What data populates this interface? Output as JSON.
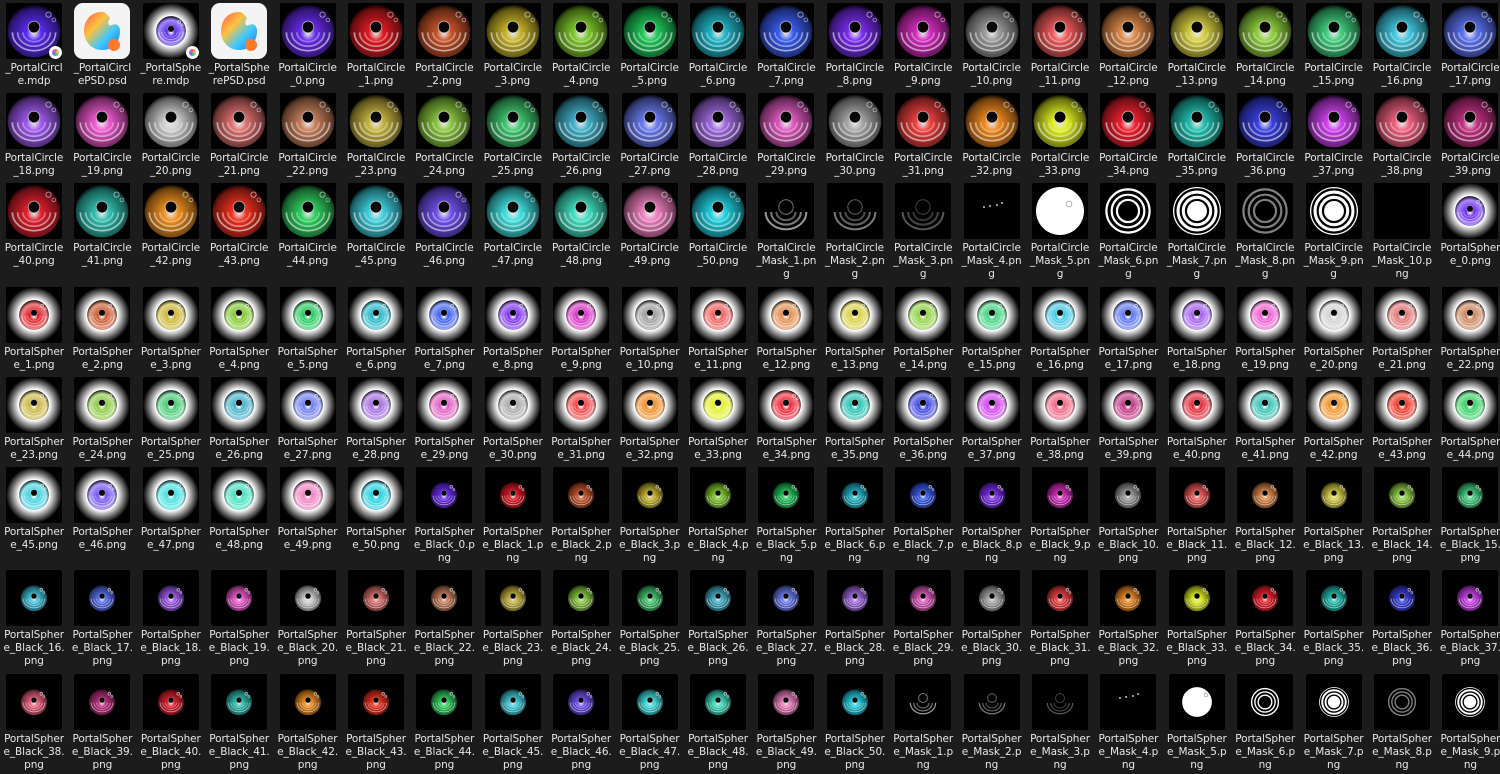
{
  "files": [
    {
      "label": "_PortalCircl\ne.mdp",
      "kind": "mdp-circle",
      "color": "#5a2cf0"
    },
    {
      "label": "_PortalCircl\nePSD.psd",
      "kind": "app"
    },
    {
      "label": "_PortalSphe\nre.mdp",
      "kind": "mdp-sphere",
      "color": "#5a2cf0"
    },
    {
      "label": "_PortalSphe\nrePSD.psd",
      "kind": "app"
    },
    {
      "label": "PortalCircle\n_0.png",
      "kind": "circle",
      "color": "#6a2cf0"
    },
    {
      "label": "PortalCircle\n_1.png",
      "kind": "circle",
      "color": "#e01b24"
    },
    {
      "label": "PortalCircle\n_2.png",
      "kind": "circle",
      "color": "#c8542a"
    },
    {
      "label": "PortalCircle\n_3.png",
      "kind": "circle",
      "color": "#c8b42a"
    },
    {
      "label": "PortalCircle\n_4.png",
      "kind": "circle",
      "color": "#7ec82a"
    },
    {
      "label": "PortalCircle\n_5.png",
      "kind": "circle",
      "color": "#1fc85a"
    },
    {
      "label": "PortalCircle\n_6.png",
      "kind": "circle",
      "color": "#1fb6c8"
    },
    {
      "label": "PortalCircle\n_7.png",
      "kind": "circle",
      "color": "#3a5cf0"
    },
    {
      "label": "PortalCircle\n_8.png",
      "kind": "circle",
      "color": "#7a2cf0"
    },
    {
      "label": "PortalCircle\n_9.png",
      "kind": "circle",
      "color": "#d62cc0"
    },
    {
      "label": "PortalCircle\n_10.png",
      "kind": "circle",
      "color": "#9a9a9a"
    },
    {
      "label": "PortalCircle\n_11.png",
      "kind": "circle",
      "color": "#f05a5a"
    },
    {
      "label": "PortalCircle\n_12.png",
      "kind": "circle",
      "color": "#e08a4a"
    },
    {
      "label": "PortalCircle\n_13.png",
      "kind": "circle",
      "color": "#d8d040"
    },
    {
      "label": "PortalCircle\n_14.png",
      "kind": "circle",
      "color": "#90d040"
    },
    {
      "label": "PortalCircle\n_15.png",
      "kind": "circle",
      "color": "#40d080"
    },
    {
      "label": "PortalCircle\n_16.png",
      "kind": "circle",
      "color": "#40c8e0"
    },
    {
      "label": "PortalCircle\n_17.png",
      "kind": "circle",
      "color": "#5a70f0"
    },
    {
      "label": "PortalCircle\n_18.png",
      "kind": "circle",
      "color": "#a05af0"
    },
    {
      "label": "PortalCircle\n_19.png",
      "kind": "circle",
      "color": "#f05ad0"
    },
    {
      "label": "PortalCircle\n_20.png",
      "kind": "circle",
      "color": "#d0d0d0"
    },
    {
      "label": "PortalCircle\n_21.png",
      "kind": "circle",
      "color": "#e07070"
    },
    {
      "label": "PortalCircle\n_22.png",
      "kind": "circle",
      "color": "#c8805a"
    },
    {
      "label": "PortalCircle\n_23.png",
      "kind": "circle",
      "color": "#c8b440"
    },
    {
      "label": "PortalCircle\n_24.png",
      "kind": "circle",
      "color": "#8ac840"
    },
    {
      "label": "PortalCircle\n_25.png",
      "kind": "circle",
      "color": "#40c870"
    },
    {
      "label": "PortalCircle\n_26.png",
      "kind": "circle",
      "color": "#40b0c8"
    },
    {
      "label": "PortalCircle\n_27.png",
      "kind": "circle",
      "color": "#6a7af0"
    },
    {
      "label": "PortalCircle\n_28.png",
      "kind": "circle",
      "color": "#a06ae0"
    },
    {
      "label": "PortalCircle\n_29.png",
      "kind": "circle",
      "color": "#e05ac0"
    },
    {
      "label": "PortalCircle\n_30.png",
      "kind": "circle",
      "color": "#a8a8a8"
    },
    {
      "label": "PortalCircle\n_31.png",
      "kind": "circle",
      "color": "#f04040"
    },
    {
      "label": "PortalCircle\n_32.png",
      "kind": "circle",
      "color": "#f08a20"
    },
    {
      "label": "PortalCircle\n_33.png",
      "kind": "circle",
      "color": "#e0f020"
    },
    {
      "label": "PortalCircle\n_34.png",
      "kind": "circle",
      "color": "#f02030"
    },
    {
      "label": "PortalCircle\n_35.png",
      "kind": "circle",
      "color": "#20c0b0"
    },
    {
      "label": "PortalCircle\n_36.png",
      "kind": "circle",
      "color": "#3a40e0"
    },
    {
      "label": "PortalCircle\n_37.png",
      "kind": "circle",
      "color": "#d040f0"
    },
    {
      "label": "PortalCircle\n_38.png",
      "kind": "circle",
      "color": "#f06080"
    },
    {
      "label": "PortalCircle\n_39.png",
      "kind": "circle",
      "color": "#c03080"
    },
    {
      "label": "PortalCircle\n_40.png",
      "kind": "circle",
      "color": "#e02030"
    },
    {
      "label": "PortalCircle\n_41.png",
      "kind": "circle",
      "color": "#30c0b0"
    },
    {
      "label": "PortalCircle\n_42.png",
      "kind": "circle",
      "color": "#f09020"
    },
    {
      "label": "PortalCircle\n_43.png",
      "kind": "circle",
      "color": "#f03020"
    },
    {
      "label": "PortalCircle\n_44.png",
      "kind": "circle",
      "color": "#30d060"
    },
    {
      "label": "PortalCircle\n_45.png",
      "kind": "circle",
      "color": "#40d0e0"
    },
    {
      "label": "PortalCircle\n_46.png",
      "kind": "circle",
      "color": "#7050f0"
    },
    {
      "label": "PortalCircle\n_47.png",
      "kind": "circle",
      "color": "#40e0e0"
    },
    {
      "label": "PortalCircle\n_48.png",
      "kind": "circle",
      "color": "#40e0c0"
    },
    {
      "label": "PortalCircle\n_49.png",
      "kind": "circle",
      "color": "#f080c0"
    },
    {
      "label": "PortalCircle\n_50.png",
      "kind": "circle",
      "color": "#20d0e0"
    },
    {
      "label": "PortalCircle\n_Mask_1.pn\ng",
      "kind": "mask-dark",
      "color": "#bfbfbf"
    },
    {
      "label": "PortalCircle\n_Mask_2.pn\ng",
      "kind": "mask-dark",
      "color": "#9a9a9a"
    },
    {
      "label": "PortalCircle\n_Mask_3.pn\ng",
      "kind": "mask-dark",
      "color": "#6a6a6a"
    },
    {
      "label": "PortalCircle\n_Mask_4.pn\ng",
      "kind": "mask-dots",
      "color": "#ffffff"
    },
    {
      "label": "PortalCircle\n_Mask_5.pn\ng",
      "kind": "mask-disc",
      "color": "#ffffff"
    },
    {
      "label": "PortalCircle\n_Mask_6.pn\ng",
      "kind": "mask-rings",
      "color": "#ffffff"
    },
    {
      "label": "PortalCircle\n_Mask_7.pn\ng",
      "kind": "mask-rings-solid",
      "color": "#ffffff"
    },
    {
      "label": "PortalCircle\n_Mask_8.pn\ng",
      "kind": "mask-rings-dim",
      "color": "#808080"
    },
    {
      "label": "PortalCircle\n_Mask_9.pn\ng",
      "kind": "mask-rings-solid",
      "color": "#ffffff"
    },
    {
      "label": "PortalCircle\n_Mask_10.p\nng",
      "kind": "mask-empty",
      "color": "#000000"
    },
    {
      "label": "PortalSpher\ne_0.png",
      "kind": "sphere",
      "color": "#6a2cf0"
    },
    {
      "label": "PortalSpher\ne_1.png",
      "kind": "sphere",
      "color": "#e01b24"
    },
    {
      "label": "PortalSpher\ne_2.png",
      "kind": "sphere",
      "color": "#c8542a"
    },
    {
      "label": "PortalSpher\ne_3.png",
      "kind": "sphere",
      "color": "#c8b42a"
    },
    {
      "label": "PortalSpher\ne_4.png",
      "kind": "sphere",
      "color": "#7ec82a"
    },
    {
      "label": "PortalSpher\ne_5.png",
      "kind": "sphere",
      "color": "#1fc85a"
    },
    {
      "label": "PortalSpher\ne_6.png",
      "kind": "sphere",
      "color": "#1fb6c8"
    },
    {
      "label": "PortalSpher\ne_7.png",
      "kind": "sphere",
      "color": "#3a5cf0"
    },
    {
      "label": "PortalSpher\ne_8.png",
      "kind": "sphere",
      "color": "#7a2cf0"
    },
    {
      "label": "PortalSpher\ne_9.png",
      "kind": "sphere",
      "color": "#d62cc0"
    },
    {
      "label": "PortalSpher\ne_10.png",
      "kind": "sphere",
      "color": "#9a9a9a"
    },
    {
      "label": "PortalSpher\ne_11.png",
      "kind": "sphere",
      "color": "#f05a5a"
    },
    {
      "label": "PortalSpher\ne_12.png",
      "kind": "sphere",
      "color": "#e08a4a"
    },
    {
      "label": "PortalSpher\ne_13.png",
      "kind": "sphere",
      "color": "#d8d040"
    },
    {
      "label": "PortalSpher\ne_14.png",
      "kind": "sphere",
      "color": "#90d040"
    },
    {
      "label": "PortalSpher\ne_15.png",
      "kind": "sphere",
      "color": "#40d080"
    },
    {
      "label": "PortalSpher\ne_16.png",
      "kind": "sphere",
      "color": "#40c8e0"
    },
    {
      "label": "PortalSpher\ne_17.png",
      "kind": "sphere",
      "color": "#5a70f0"
    },
    {
      "label": "PortalSpher\ne_18.png",
      "kind": "sphere",
      "color": "#a05af0"
    },
    {
      "label": "PortalSpher\ne_19.png",
      "kind": "sphere",
      "color": "#f05ad0"
    },
    {
      "label": "PortalSpher\ne_20.png",
      "kind": "sphere",
      "color": "#d0d0d0"
    },
    {
      "label": "PortalSpher\ne_21.png",
      "kind": "sphere",
      "color": "#e07070"
    },
    {
      "label": "PortalSpher\ne_22.png",
      "kind": "sphere",
      "color": "#c8805a"
    },
    {
      "label": "PortalSpher\ne_23.png",
      "kind": "sphere",
      "color": "#c8b440"
    },
    {
      "label": "PortalSpher\ne_24.png",
      "kind": "sphere",
      "color": "#8ac840"
    },
    {
      "label": "PortalSpher\ne_25.png",
      "kind": "sphere",
      "color": "#40c870"
    },
    {
      "label": "PortalSpher\ne_26.png",
      "kind": "sphere",
      "color": "#40b0c8"
    },
    {
      "label": "PortalSpher\ne_27.png",
      "kind": "sphere",
      "color": "#6a7af0"
    },
    {
      "label": "PortalSpher\ne_28.png",
      "kind": "sphere",
      "color": "#a06ae0"
    },
    {
      "label": "PortalSpher\ne_29.png",
      "kind": "sphere",
      "color": "#e05ac0"
    },
    {
      "label": "PortalSpher\ne_30.png",
      "kind": "sphere",
      "color": "#a8a8a8"
    },
    {
      "label": "PortalSpher\ne_31.png",
      "kind": "sphere",
      "color": "#f04040"
    },
    {
      "label": "PortalSpher\ne_32.png",
      "kind": "sphere",
      "color": "#f08a20"
    },
    {
      "label": "PortalSpher\ne_33.png",
      "kind": "sphere",
      "color": "#e0f020"
    },
    {
      "label": "PortalSpher\ne_34.png",
      "kind": "sphere",
      "color": "#f02030"
    },
    {
      "label": "PortalSpher\ne_35.png",
      "kind": "sphere",
      "color": "#20c0b0"
    },
    {
      "label": "PortalSpher\ne_36.png",
      "kind": "sphere",
      "color": "#3a40e0"
    },
    {
      "label": "PortalSpher\ne_37.png",
      "kind": "sphere",
      "color": "#d040f0"
    },
    {
      "label": "PortalSpher\ne_38.png",
      "kind": "sphere",
      "color": "#f06080"
    },
    {
      "label": "PortalSpher\ne_39.png",
      "kind": "sphere",
      "color": "#c03080"
    },
    {
      "label": "PortalSpher\ne_40.png",
      "kind": "sphere",
      "color": "#e02030"
    },
    {
      "label": "PortalSpher\ne_41.png",
      "kind": "sphere",
      "color": "#30c0b0"
    },
    {
      "label": "PortalSpher\ne_42.png",
      "kind": "sphere",
      "color": "#f09020"
    },
    {
      "label": "PortalSpher\ne_43.png",
      "kind": "sphere",
      "color": "#f03020"
    },
    {
      "label": "PortalSpher\ne_44.png",
      "kind": "sphere",
      "color": "#30d060"
    },
    {
      "label": "PortalSpher\ne_45.png",
      "kind": "sphere",
      "color": "#40d0e0"
    },
    {
      "label": "PortalSpher\ne_46.png",
      "kind": "sphere",
      "color": "#7050f0"
    },
    {
      "label": "PortalSpher\ne_47.png",
      "kind": "sphere",
      "color": "#40e0e0"
    },
    {
      "label": "PortalSpher\ne_48.png",
      "kind": "sphere",
      "color": "#40e0c0"
    },
    {
      "label": "PortalSpher\ne_49.png",
      "kind": "sphere",
      "color": "#f080c0"
    },
    {
      "label": "PortalSpher\ne_50.png",
      "kind": "sphere",
      "color": "#20d0e0"
    },
    {
      "label": "PortalSpher\ne_Black_0.p\nng",
      "kind": "black",
      "color": "#6a2cf0"
    },
    {
      "label": "PortalSpher\ne_Black_1.p\nng",
      "kind": "black",
      "color": "#e01b24"
    },
    {
      "label": "PortalSpher\ne_Black_2.p\nng",
      "kind": "black",
      "color": "#c8542a"
    },
    {
      "label": "PortalSpher\ne_Black_3.p\nng",
      "kind": "black",
      "color": "#c8b42a"
    },
    {
      "label": "PortalSpher\ne_Black_4.p\nng",
      "kind": "black",
      "color": "#7ec82a"
    },
    {
      "label": "PortalSpher\ne_Black_5.p\nng",
      "kind": "black",
      "color": "#1fc85a"
    },
    {
      "label": "PortalSpher\ne_Black_6.p\nng",
      "kind": "black",
      "color": "#1fb6c8"
    },
    {
      "label": "PortalSpher\ne_Black_7.p\nng",
      "kind": "black",
      "color": "#3a5cf0"
    },
    {
      "label": "PortalSpher\ne_Black_8.p\nng",
      "kind": "black",
      "color": "#7a2cf0"
    },
    {
      "label": "PortalSpher\ne_Black_9.p\nng",
      "kind": "black",
      "color": "#d62cc0"
    },
    {
      "label": "PortalSpher\ne_Black_10.\npng",
      "kind": "black",
      "color": "#9a9a9a"
    },
    {
      "label": "PortalSpher\ne_Black_11.\npng",
      "kind": "black",
      "color": "#f05a5a"
    },
    {
      "label": "PortalSpher\ne_Black_12.\npng",
      "kind": "black",
      "color": "#e08a4a"
    },
    {
      "label": "PortalSpher\ne_Black_13.\npng",
      "kind": "black",
      "color": "#d8d040"
    },
    {
      "label": "PortalSpher\ne_Black_14.\npng",
      "kind": "black",
      "color": "#90d040"
    },
    {
      "label": "PortalSpher\ne_Black_15.\npng",
      "kind": "black",
      "color": "#40d080"
    },
    {
      "label": "PortalSpher\ne_Black_16.\npng",
      "kind": "black",
      "color": "#40c8e0"
    },
    {
      "label": "PortalSpher\ne_Black_17.\npng",
      "kind": "black",
      "color": "#5a70f0"
    },
    {
      "label": "PortalSpher\ne_Black_18.\npng",
      "kind": "black",
      "color": "#a05af0"
    },
    {
      "label": "PortalSpher\ne_Black_19.\npng",
      "kind": "black",
      "color": "#f05ad0"
    },
    {
      "label": "PortalSpher\ne_Black_20.\npng",
      "kind": "black",
      "color": "#d0d0d0"
    },
    {
      "label": "PortalSpher\ne_Black_21.\npng",
      "kind": "black",
      "color": "#e07070"
    },
    {
      "label": "PortalSpher\ne_Black_22.\npng",
      "kind": "black",
      "color": "#c8805a"
    },
    {
      "label": "PortalSpher\ne_Black_23.\npng",
      "kind": "black",
      "color": "#c8b440"
    },
    {
      "label": "PortalSpher\ne_Black_24.\npng",
      "kind": "black",
      "color": "#8ac840"
    },
    {
      "label": "PortalSpher\ne_Black_25.\npng",
      "kind": "black",
      "color": "#40c870"
    },
    {
      "label": "PortalSpher\ne_Black_26.\npng",
      "kind": "black",
      "color": "#40b0c8"
    },
    {
      "label": "PortalSpher\ne_Black_27.\npng",
      "kind": "black",
      "color": "#6a7af0"
    },
    {
      "label": "PortalSpher\ne_Black_28.\npng",
      "kind": "black",
      "color": "#a06ae0"
    },
    {
      "label": "PortalSpher\ne_Black_29.\npng",
      "kind": "black",
      "color": "#e05ac0"
    },
    {
      "label": "PortalSpher\ne_Black_30.\npng",
      "kind": "black",
      "color": "#a8a8a8"
    },
    {
      "label": "PortalSpher\ne_Black_31.\npng",
      "kind": "black",
      "color": "#f04040"
    },
    {
      "label": "PortalSpher\ne_Black_32.\npng",
      "kind": "black",
      "color": "#f08a20"
    },
    {
      "label": "PortalSpher\ne_Black_33.\npng",
      "kind": "black",
      "color": "#e0f020"
    },
    {
      "label": "PortalSpher\ne_Black_34.\npng",
      "kind": "black",
      "color": "#f02030"
    },
    {
      "label": "PortalSpher\ne_Black_35.\npng",
      "kind": "black",
      "color": "#20c0b0"
    },
    {
      "label": "PortalSpher\ne_Black_36.\npng",
      "kind": "black",
      "color": "#3a40e0"
    },
    {
      "label": "PortalSpher\ne_Black_37.\npng",
      "kind": "black",
      "color": "#d040f0"
    },
    {
      "label": "PortalSpher\ne_Black_38.\npng",
      "kind": "black",
      "color": "#f06080"
    },
    {
      "label": "PortalSpher\ne_Black_39.\npng",
      "kind": "black",
      "color": "#c03080"
    },
    {
      "label": "PortalSpher\ne_Black_40.\npng",
      "kind": "black",
      "color": "#e02030"
    },
    {
      "label": "PortalSpher\ne_Black_41.\npng",
      "kind": "black",
      "color": "#30c0b0"
    },
    {
      "label": "PortalSpher\ne_Black_42.\npng",
      "kind": "black",
      "color": "#f09020"
    },
    {
      "label": "PortalSpher\ne_Black_43.\npng",
      "kind": "black",
      "color": "#f03020"
    },
    {
      "label": "PortalSpher\ne_Black_44.\npng",
      "kind": "black",
      "color": "#30d060"
    },
    {
      "label": "PortalSpher\ne_Black_45.\npng",
      "kind": "black",
      "color": "#40d0e0"
    },
    {
      "label": "PortalSpher\ne_Black_46.\npng",
      "kind": "black",
      "color": "#7050f0"
    },
    {
      "label": "PortalSpher\ne_Black_47.\npng",
      "kind": "black",
      "color": "#40e0e0"
    },
    {
      "label": "PortalSpher\ne_Black_48.\npng",
      "kind": "black",
      "color": "#40e0c0"
    },
    {
      "label": "PortalSpher\ne_Black_49.\npng",
      "kind": "black",
      "color": "#f080c0"
    },
    {
      "label": "PortalSpher\ne_Black_50.\npng",
      "kind": "black",
      "color": "#20d0e0"
    },
    {
      "label": "PortalSpher\ne_Mask_1.p\nng",
      "kind": "smask-dark",
      "color": "#bfbfbf"
    },
    {
      "label": "PortalSpher\ne_Mask_2.p\nng",
      "kind": "smask-dark",
      "color": "#9a9a9a"
    },
    {
      "label": "PortalSpher\ne_Mask_3.p\nng",
      "kind": "smask-dark",
      "color": "#6a6a6a"
    },
    {
      "label": "PortalSpher\ne_Mask_4.p\nng",
      "kind": "smask-dots",
      "color": "#ffffff"
    },
    {
      "label": "PortalSpher\ne_Mask_5.p\nng",
      "kind": "smask-disc",
      "color": "#ffffff"
    },
    {
      "label": "PortalSpher\ne_Mask_6.p\nng",
      "kind": "smask-rings",
      "color": "#ffffff"
    },
    {
      "label": "PortalSpher\ne_Mask_7.p\nng",
      "kind": "smask-rings-solid",
      "color": "#ffffff"
    },
    {
      "label": "PortalSpher\ne_Mask_8.p\nng",
      "kind": "smask-rings-dim",
      "color": "#808080"
    },
    {
      "label": "PortalSpher\ne_Mask_9.p\nng",
      "kind": "smask-rings-solid",
      "color": "#ffffff"
    }
  ]
}
